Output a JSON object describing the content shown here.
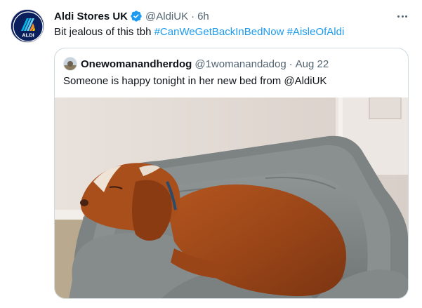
{
  "tweet": {
    "author_name": "Aldi Stores UK",
    "author_handle": "@AldiUK",
    "separator": "·",
    "time": "6h",
    "avatar_text": "ALDI",
    "text_plain": "Bit jealous of this tbh ",
    "hashtags": [
      "#CanWeGetBackInBedNow",
      "#AisleOfAldi"
    ],
    "verified_color": "#1d9bf0",
    "brand_color": "#0b1f5c"
  },
  "quoted": {
    "author_name": "Onewomanandherdog",
    "author_handle": "@1womanandadog",
    "separator": "·",
    "date": "Aug 22",
    "text": "Someone is happy tonight in her new bed from @AldiUK"
  },
  "icons": {
    "verified": "verified-badge-icon",
    "more": "more-options-icon"
  }
}
